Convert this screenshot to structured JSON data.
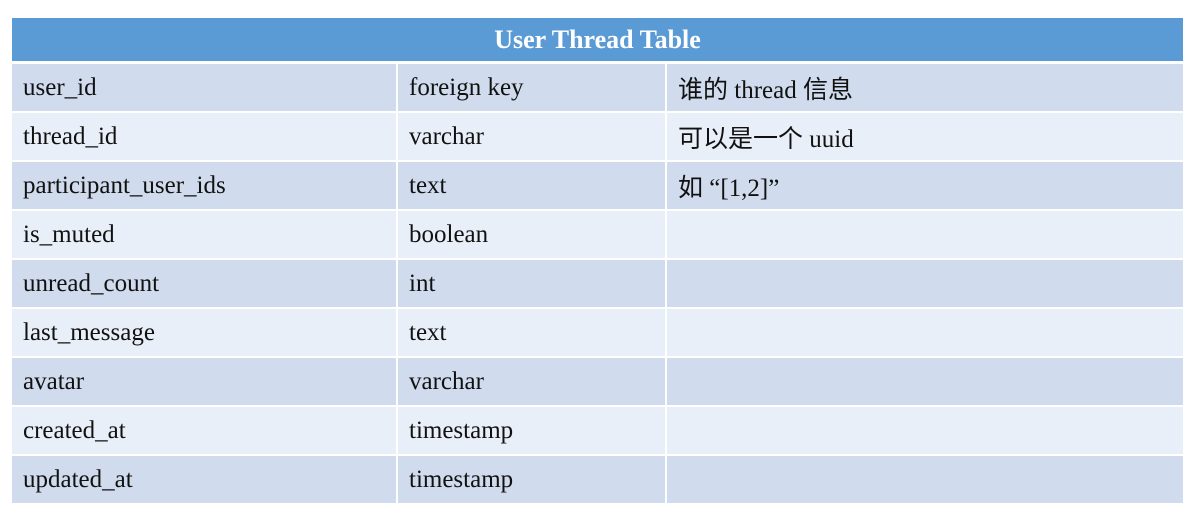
{
  "table": {
    "title": "User Thread Table",
    "rows": [
      [
        "user_id",
        "foreign key",
        "谁的 thread 信息"
      ],
      [
        "thread_id",
        "varchar",
        "可以是一个 uuid"
      ],
      [
        "participant_user_ids",
        "text",
        "如 “[1,2]”"
      ],
      [
        "is_muted",
        "boolean",
        ""
      ],
      [
        "unread_count",
        "int",
        ""
      ],
      [
        "last_message",
        "text",
        ""
      ],
      [
        "avatar",
        "varchar",
        ""
      ],
      [
        "created_at",
        "timestamp",
        ""
      ],
      [
        "updated_at",
        "timestamp",
        ""
      ]
    ],
    "colors": {
      "header_bg": "#5b9bd5",
      "row_dark": "#d0dcee",
      "row_light": "#e9eff8"
    }
  }
}
